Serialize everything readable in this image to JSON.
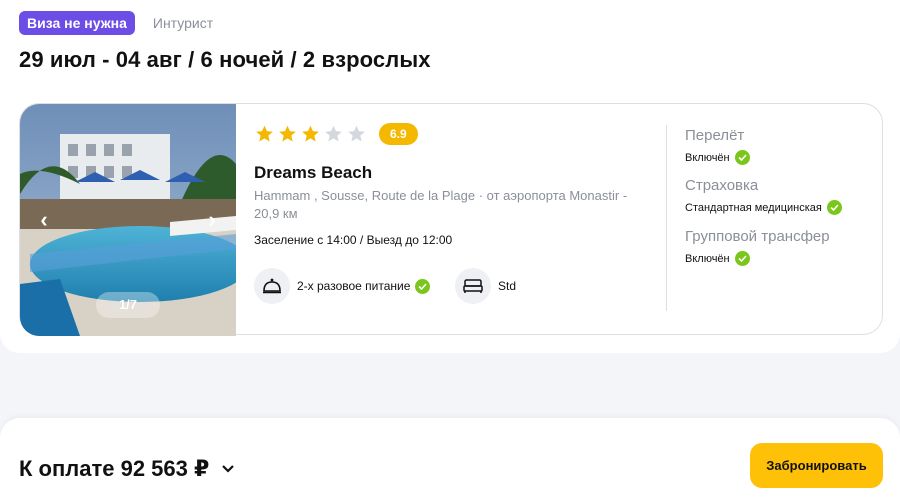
{
  "badges": {
    "visa": "Виза не нужна",
    "operator": "Интурист"
  },
  "trip": {
    "title": "29 июл - 04 авг / 6 ночей / 2 взрослых"
  },
  "hotel": {
    "stars": 3,
    "stars_max": 5,
    "rating": "6.9",
    "name": "Dreams Beach",
    "location": "Hammam , Sousse, Route de la Plage  ·  от аэропорта Monastir - 20,9 км",
    "checkin": "Заселение с 14:00 / Выезд до 12:00",
    "photo_counter": "1/7",
    "meal": "2-х разовое питание",
    "room": "Std"
  },
  "included": [
    {
      "title": "Перелёт",
      "value": "Включён"
    },
    {
      "title": "Страховка",
      "value": "Стандартная медицинская"
    },
    {
      "title": "Групповой трансфер",
      "value": "Включён"
    }
  ],
  "footer": {
    "total": "К оплате 92 563 ₽",
    "book_label": "Забронировать"
  },
  "colors": {
    "accent_purple": "#6c4ee6",
    "star": "#f5b800",
    "check": "#7ac61b",
    "button": "#ffc107"
  },
  "icons": [
    "chevron-left-icon",
    "chevron-right-icon",
    "star-icon",
    "cloche-icon",
    "bed-icon",
    "check-icon",
    "chevron-down-icon"
  ]
}
